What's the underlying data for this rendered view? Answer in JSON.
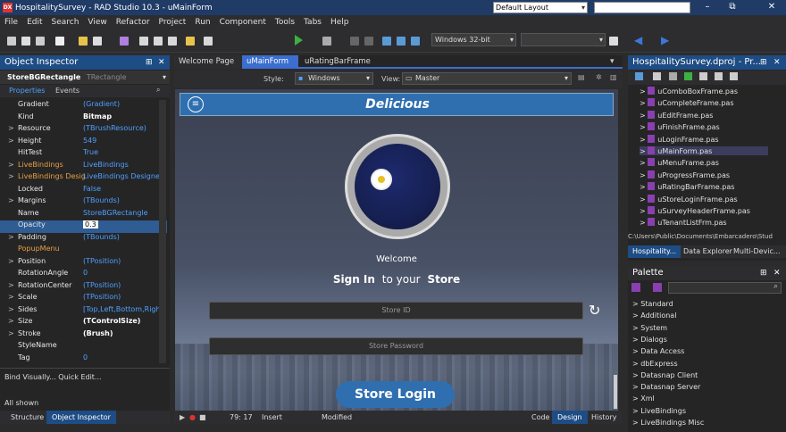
{
  "window": {
    "title": "HospitalitySurvey - RAD Studio 10.3 - uMainForm",
    "logo": "DX"
  },
  "layout_select": "Default Layout",
  "window_controls": {
    "minimize": "–",
    "maximize": "□",
    "close": "✕",
    "restore": "⧉"
  },
  "menu": [
    "File",
    "Edit",
    "Search",
    "View",
    "Refactor",
    "Project",
    "Run",
    "Component",
    "Tools",
    "Tabs",
    "Help"
  ],
  "toolbar": {
    "platform": "Windows 32-bit"
  },
  "object_inspector": {
    "title": "Object Inspector",
    "selected_name": "StoreBGRectangle",
    "selected_type": "TRectangle",
    "tabs": [
      "Properties",
      "Events"
    ],
    "properties": [
      {
        "name": "Gradient",
        "value": "(Gradient)",
        "expand": ""
      },
      {
        "name": "Kind",
        "value": "Bitmap",
        "expand": ""
      },
      {
        "name": "Resource",
        "value": "(TBrushResource)",
        "expand": ">"
      },
      {
        "name": "Height",
        "value": "549",
        "expand": ">"
      },
      {
        "name": "HitTest",
        "value": "True",
        "expand": ""
      },
      {
        "name": "LiveBindings",
        "value": "LiveBindings",
        "expand": ">"
      },
      {
        "name": "LiveBindings Desig",
        "value": "LiveBindings Designer",
        "expand": ">"
      },
      {
        "name": "Locked",
        "value": "False",
        "expand": ""
      },
      {
        "name": "Margins",
        "value": "(TBounds)",
        "expand": ">"
      },
      {
        "name": "Name",
        "value": "StoreBGRectangle",
        "expand": ""
      },
      {
        "name": "Opacity",
        "value": "0.3",
        "expand": ""
      },
      {
        "name": "Padding",
        "value": "(TBounds)",
        "expand": ">"
      },
      {
        "name": "PopupMenu",
        "value": "",
        "expand": ""
      },
      {
        "name": "Position",
        "value": "(TPosition)",
        "expand": ">"
      },
      {
        "name": "RotationAngle",
        "value": "0",
        "expand": ""
      },
      {
        "name": "RotationCenter",
        "value": "(TPosition)",
        "expand": ">"
      },
      {
        "name": "Scale",
        "value": "(TPosition)",
        "expand": ">"
      },
      {
        "name": "Sides",
        "value": "[Top,Left,Bottom,Right]",
        "expand": ">"
      },
      {
        "name": "Size",
        "value": "(TControlSize)",
        "expand": ">"
      },
      {
        "name": "Stroke",
        "value": "(Brush)",
        "expand": ">"
      },
      {
        "name": "StyleName",
        "value": "",
        "expand": ""
      },
      {
        "name": "Tag",
        "value": "0",
        "expand": ""
      }
    ],
    "links": "Bind Visually...  Quick Edit...",
    "all_shown": "All shown",
    "bottom_tabs": [
      "Structure",
      "Object Inspector"
    ]
  },
  "editor": {
    "tabs": [
      "Welcome Page",
      "uMainForm",
      "uRatingBarFrame"
    ],
    "style_label": "Style:",
    "style_value": "Windows",
    "view_label": "View:",
    "view_value": "Master"
  },
  "form": {
    "title": "Delicious",
    "welcome": "Welcome",
    "sign_in": "Sign In",
    "to_your": "to your",
    "store": "Store",
    "store_id_placeholder": "Store ID",
    "store_password_placeholder": "Store Password",
    "login_button": "Store Login"
  },
  "status_bar": {
    "position": "79: 17",
    "mode": "Insert",
    "modified": "Modified",
    "tabs": [
      "Code",
      "Design",
      "History"
    ]
  },
  "project": {
    "title": "HospitalitySurvey.dproj - Pr...",
    "files": [
      "uComboBoxFrame.pas",
      "uCompleteFrame.pas",
      "uEditFrame.pas",
      "uFinishFrame.pas",
      "uLoginFrame.pas",
      "uMainForm.pas",
      "uMenuFrame.pas",
      "uProgressFrame.pas",
      "uRatingBarFrame.pas",
      "uStoreLoginFrame.pas",
      "uSurveyHeaderFrame.pas",
      "uTenantListFrm.pas"
    ],
    "path": "C:\\Users\\Public\\Documents\\Embarcadero\\Stud",
    "tabs": [
      "Hospitality...",
      "Data Explorer",
      "Multi-Devic..."
    ]
  },
  "palette": {
    "title": "Palette",
    "items": [
      "Standard",
      "Additional",
      "System",
      "Dialogs",
      "Data Access",
      "dbExpress",
      "Datasnap Client",
      "Datasnap Server",
      "Xml",
      "LiveBindings",
      "LiveBindings Misc"
    ]
  }
}
